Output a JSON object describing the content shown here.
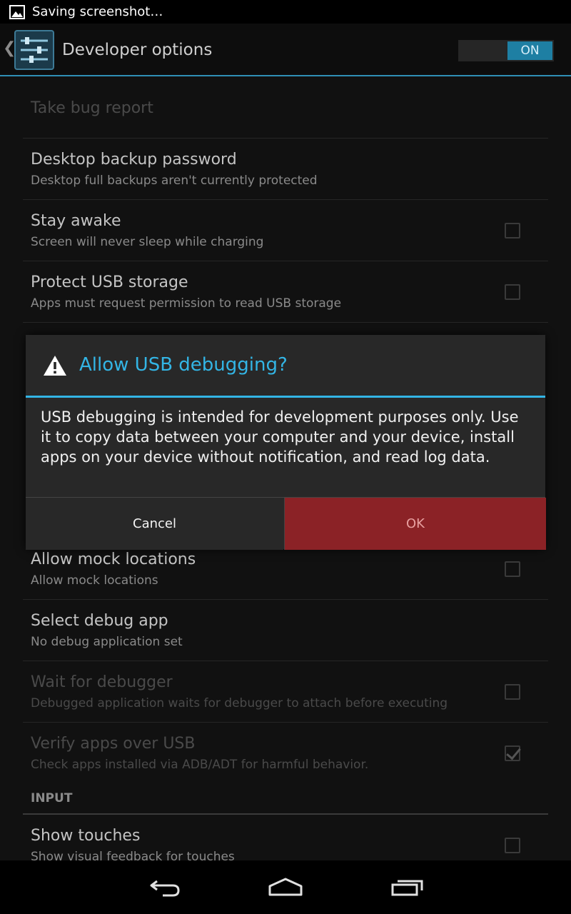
{
  "status_bar": {
    "notification_text": "Saving screenshot…",
    "notification_icon": "image-icon"
  },
  "action_bar": {
    "title": "Developer options",
    "toggle_label": "ON",
    "accent_color": "#33b5e5"
  },
  "settings": {
    "take_bug_report": "Take bug report",
    "desktop_backup": {
      "title": "Desktop backup password",
      "summary": "Desktop full backups aren't currently protected"
    },
    "stay_awake": {
      "title": "Stay awake",
      "summary": "Screen will never sleep while charging",
      "checked": false
    },
    "protect_usb": {
      "title": "Protect USB storage",
      "summary": "Apps must request permission to read USB storage",
      "checked": false
    },
    "mock_locations": {
      "title": "Allow mock locations",
      "summary": "Allow mock locations",
      "checked": false
    },
    "debug_app": {
      "title": "Select debug app",
      "summary": "No debug application set"
    },
    "wait_debugger": {
      "title": "Wait for debugger",
      "summary": "Debugged application waits for debugger to attach before executing",
      "checked": false
    },
    "verify_apps": {
      "title": "Verify apps over USB",
      "summary": "Check apps installed via ADB/ADT for harmful behavior.",
      "checked": true
    },
    "input_header": "INPUT",
    "show_touches": {
      "title": "Show touches",
      "summary": "Show visual feedback for touches",
      "checked": false
    }
  },
  "dialog": {
    "title": "Allow USB debugging?",
    "message": "USB debugging is intended for development purposes only. Use it to copy data between your computer and your device, install apps on your device without notification, and read log data.",
    "cancel_label": "Cancel",
    "ok_label": "OK",
    "ok_color": "#8b2226"
  }
}
